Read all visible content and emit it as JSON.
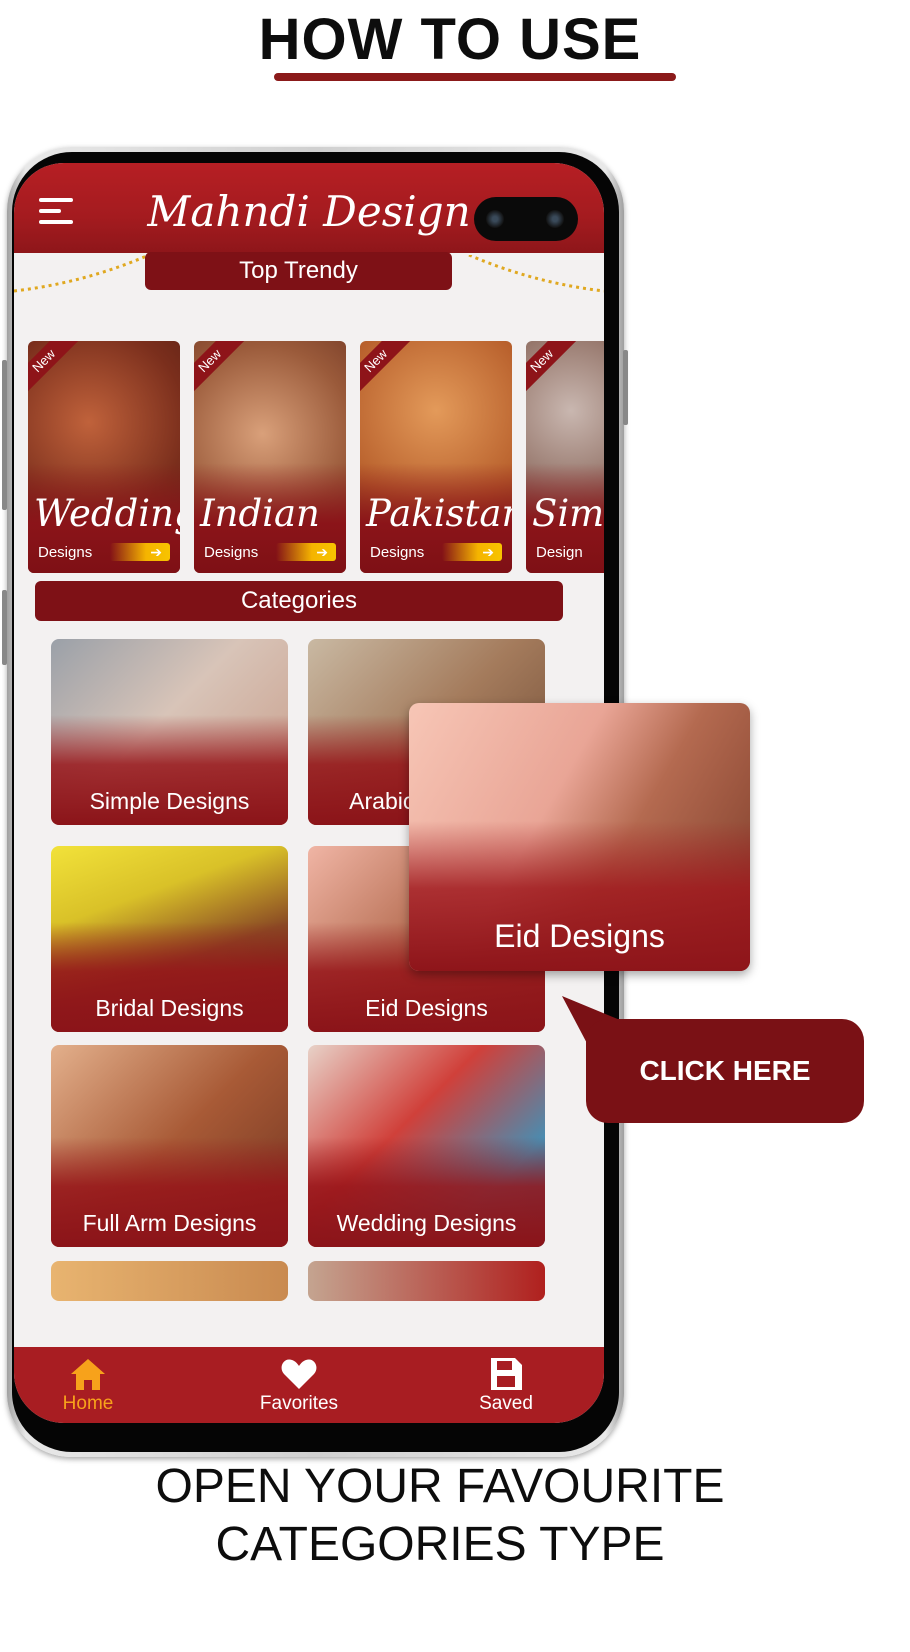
{
  "heading": "HOW TO USE",
  "app": {
    "title": "Mahndi Design",
    "top_trendy_label": "Top Trendy",
    "categories_label": "Categories",
    "trendy": [
      {
        "ribbon": "New",
        "title": "Wedding",
        "subtitle": "Designs"
      },
      {
        "ribbon": "New",
        "title": "Indian",
        "subtitle": "Designs"
      },
      {
        "ribbon": "New",
        "title": "Pakistani",
        "subtitle": "Designs"
      },
      {
        "ribbon": "New",
        "title": "Sim",
        "subtitle": "Design"
      }
    ],
    "categories": [
      {
        "label": "Simple Designs"
      },
      {
        "label": "Arabic Designs"
      },
      {
        "label": "Bridal Designs"
      },
      {
        "label": "Eid Designs"
      },
      {
        "label": "Full Arm Designs"
      },
      {
        "label": "Wedding Designs"
      }
    ],
    "nav": [
      {
        "label": "Home",
        "icon": "home-icon",
        "active": true
      },
      {
        "label": "Favorites",
        "icon": "heart-icon",
        "active": false
      },
      {
        "label": "Saved",
        "icon": "save-icon",
        "active": false
      }
    ]
  },
  "callout": {
    "zoom_label": "Eid Designs",
    "click_text": "CLICK HERE"
  },
  "footer": {
    "line1": "OPEN YOUR FAVOURITE",
    "line2": "CATEGORIES TYPE"
  },
  "colors": {
    "brand": "#a81d22",
    "dark_brand": "#7e1116",
    "nav_active": "#f7a21b"
  }
}
